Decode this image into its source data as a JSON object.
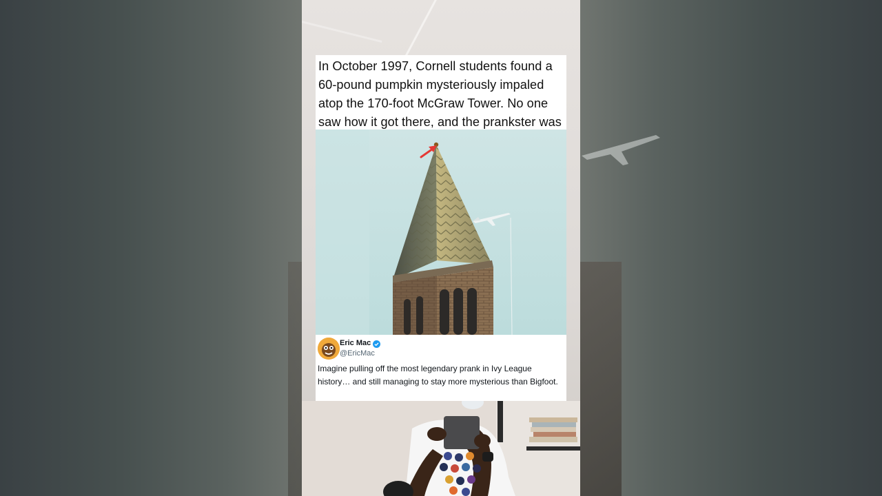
{
  "caption": {
    "lines": [
      "In October 1997, Cornell students found a",
      "60-pound pumpkin mysteriously impaled",
      "atop the 170-foot McGraw Tower. No one",
      "saw how it got there, and the prankster was"
    ]
  },
  "photo": {
    "subject": "McGraw Tower spire with pumpkin on top",
    "arrow_icon": "red-arrow-icon",
    "plane_icon": "airplane-icon"
  },
  "tweet": {
    "author_name": "Eric Mac",
    "author_handle": "@EricMac",
    "verified": true,
    "verified_color": "#1d9bf0",
    "text": "Imagine pulling off the most legendary prank in Ivy League history… and still managing to stay more mysterious than Bigfoot."
  },
  "colors": {
    "sky": "#c5e1e1",
    "card": "#ffffff",
    "arrow": "#e53935"
  }
}
